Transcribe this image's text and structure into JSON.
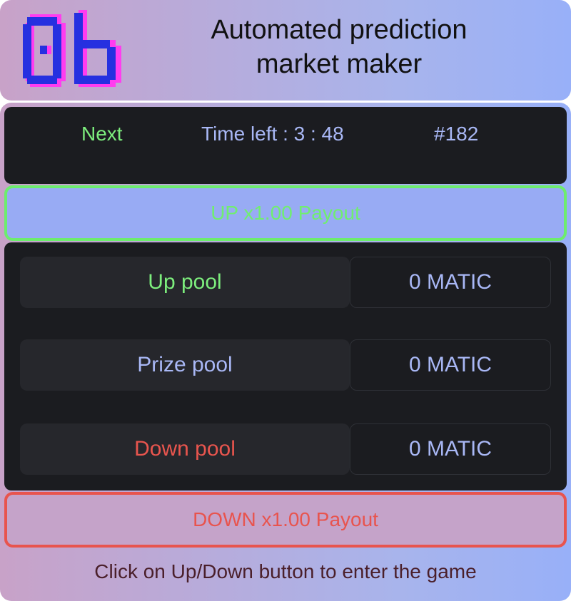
{
  "header": {
    "logo_text": "0b",
    "title_line1": "Automated prediction",
    "title_line2": "market maker"
  },
  "round": {
    "status": "Next",
    "time_left": "Time left : 3 : 48",
    "number": "#182"
  },
  "up_button": {
    "label": "UP x1.00 Payout"
  },
  "pools": [
    {
      "label": "Up pool",
      "value": "0 MATIC"
    },
    {
      "label": "Prize pool",
      "value": "0 MATIC"
    },
    {
      "label": "Down pool",
      "value": "0 MATIC"
    }
  ],
  "down_button": {
    "label": "DOWN x1.00 Payout"
  },
  "hint": "Click on Up/Down button to enter the game",
  "colors": {
    "up": "#7dee7d",
    "down": "#e8554e",
    "accent": "#a9b8f6",
    "panel": "#1b1c20"
  }
}
